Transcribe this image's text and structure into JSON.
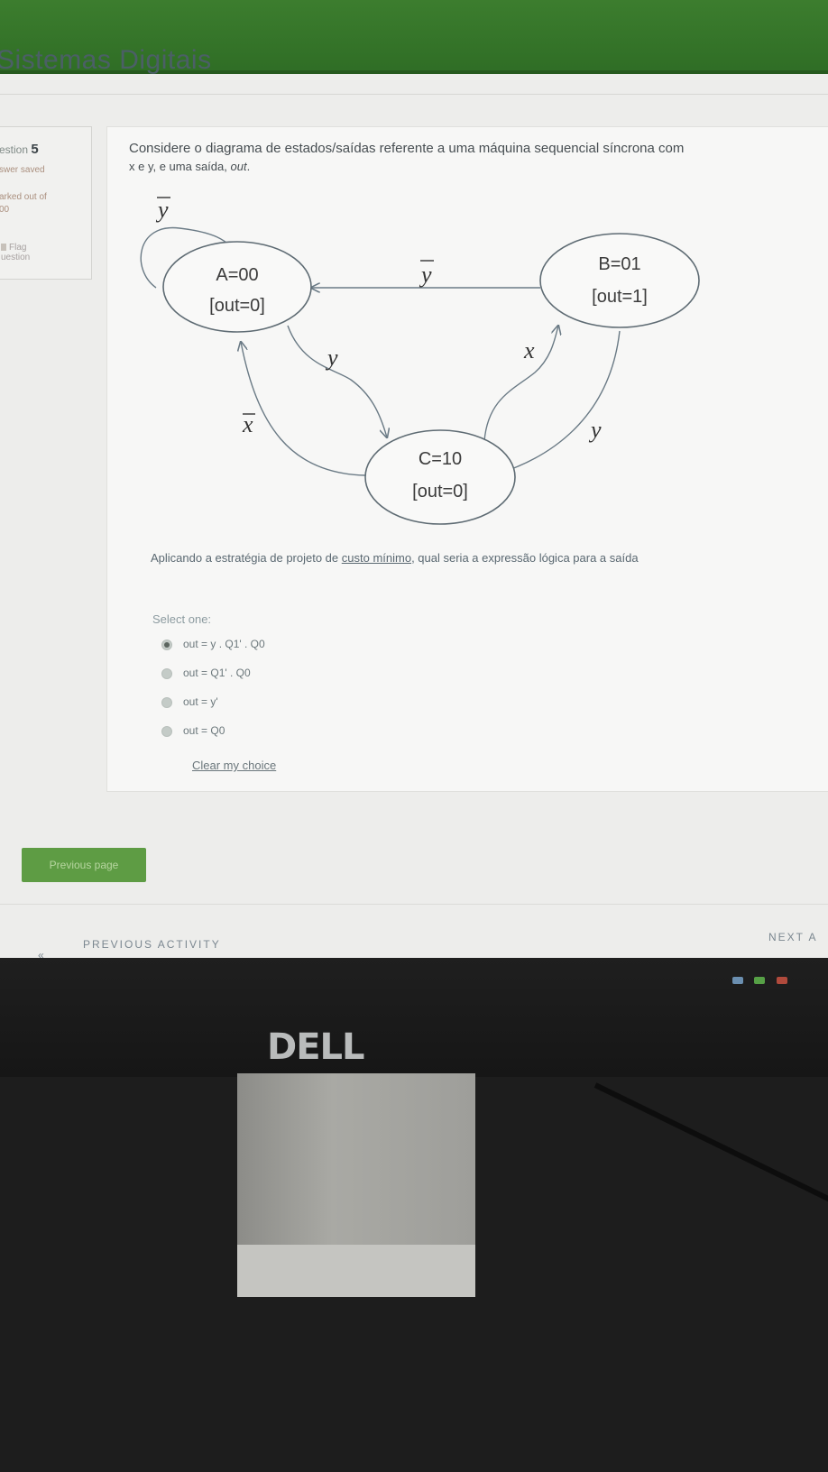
{
  "header": {
    "site_title": "Sistemas Digitais"
  },
  "question_info": {
    "number_prefix": "estion",
    "number": "5",
    "status": "swer saved",
    "marked_line1": "arked out of",
    "marked_line2": "00",
    "flag_line1": "Flag",
    "flag_line2": "uestion"
  },
  "question": {
    "text_line1": "Considere o diagrama de estados/saídas referente a uma máquina sequencial síncrona com",
    "text_line2_prefix": "x e y, e uma saída, ",
    "text_line2_italic": "out",
    "text_line2_suffix": ".",
    "prompt_prefix": "Aplicando a estratégia de projeto de ",
    "prompt_underlined": "custo mínimo",
    "prompt_suffix": ", qual seria a expressão lógica para a saída"
  },
  "diagram": {
    "state_a": {
      "name": "A=00",
      "output": "[out=0]"
    },
    "state_b": {
      "name": "B=01",
      "output": "[out=1]"
    },
    "state_c": {
      "name": "C=10",
      "output": "[out=0]"
    },
    "label_ybar_self": "y",
    "label_ybar_ba": "y",
    "label_y_ac": "y",
    "label_x_cb": "x",
    "label_y_bc": "y",
    "label_xbar_ca": "x"
  },
  "answer": {
    "select_label": "Select one:",
    "options": [
      "out = y . Q1' . Q0",
      "out = Q1' . Q0",
      "out = y'",
      "out = Q0"
    ],
    "selected_index": 0,
    "clear_label": "Clear my choice"
  },
  "navigation": {
    "previous_page_label": "Previous page",
    "previous_activity_label": "PREVIOUS ACTIVITY",
    "next_activity_label": "NEXT A",
    "back_arrow": "«"
  },
  "monitor": {
    "brand": "DELL"
  },
  "colors": {
    "header_green": "#2f6d25",
    "button_green": "#5e9c44"
  }
}
